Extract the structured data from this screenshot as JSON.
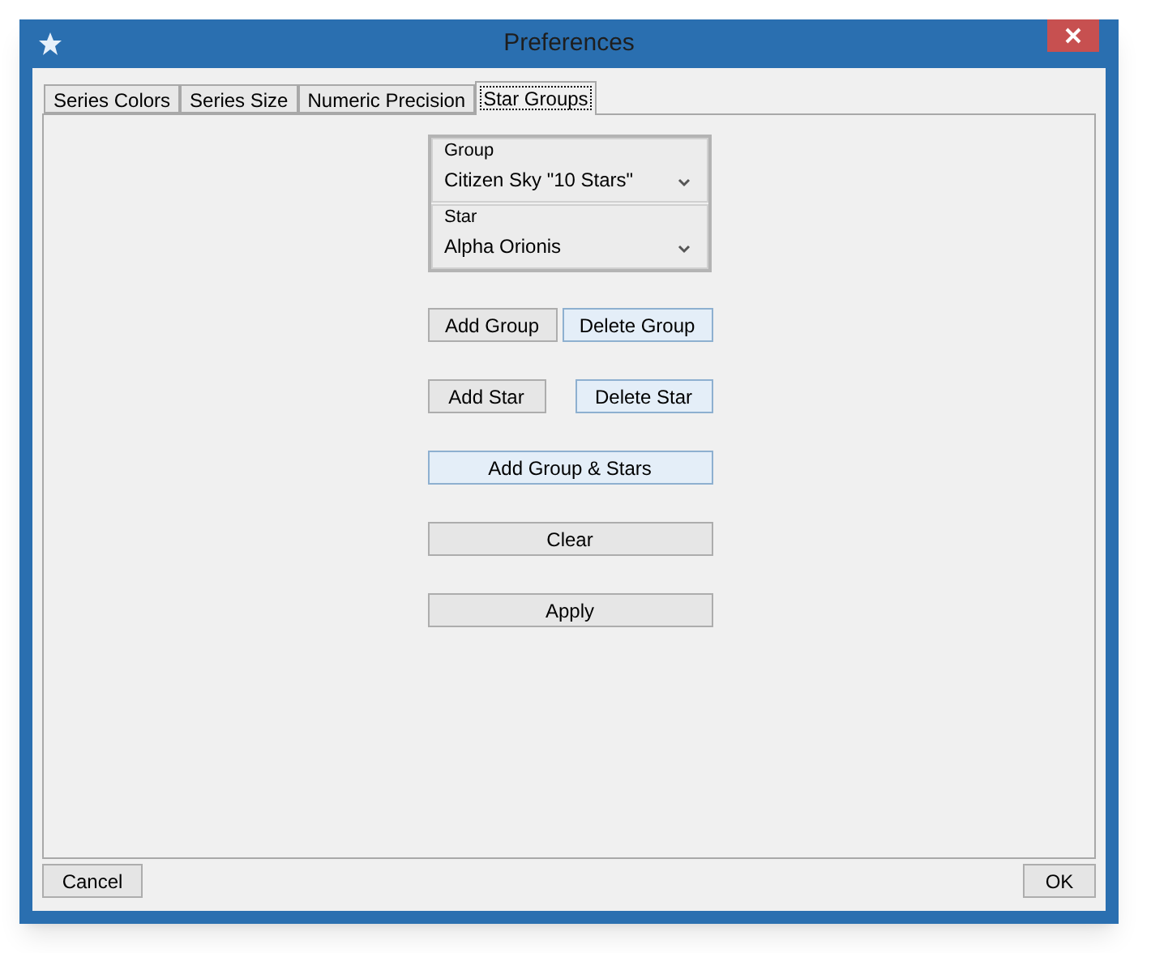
{
  "window": {
    "title": "Preferences"
  },
  "tabs": [
    {
      "label": "Series Colors",
      "selected": false
    },
    {
      "label": "Series Size",
      "selected": false
    },
    {
      "label": "Numeric Precision",
      "selected": false
    },
    {
      "label": "Star Groups",
      "selected": true
    }
  ],
  "selectors": [
    {
      "label": "Group",
      "value": "Citizen Sky \"10 Stars\""
    },
    {
      "label": "Star",
      "value": "Alpha Orionis"
    }
  ],
  "button_rows": [
    [
      {
        "label": "Add Group",
        "highlighted": false
      },
      {
        "label": "Delete Group",
        "highlighted": true
      }
    ],
    [
      {
        "label": "Add Star",
        "highlighted": false
      },
      {
        "label": "Delete Star",
        "highlighted": true
      }
    ],
    [
      {
        "label": "Add Group & Stars",
        "highlighted": true
      }
    ],
    [
      {
        "label": "Clear",
        "highlighted": false
      }
    ],
    [
      {
        "label": "Apply",
        "highlighted": false
      }
    ]
  ],
  "footer": {
    "cancel": "Cancel",
    "ok": "OK"
  }
}
